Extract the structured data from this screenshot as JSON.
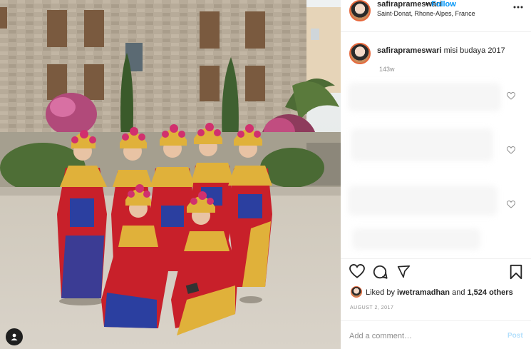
{
  "post": {
    "username": "safiraprameswari",
    "separator": "•",
    "follow_label": "Follow",
    "location": "Saint-Donat, Rhone-Alpes, France",
    "caption": {
      "username": "safiraprameswari",
      "text": "misi budaya 2017",
      "time": "143w"
    },
    "likes": {
      "prefix": "Liked by",
      "user": "iwetramadhan",
      "connector": "and",
      "others": "1,524 others"
    },
    "date": "AUGUST 2, 2017",
    "comment_placeholder": "Add a comment…",
    "post_label": "Post"
  },
  "icons": {
    "header": "more-options-icon",
    "actions": [
      "heart-icon",
      "comment-bubble-icon",
      "share-paper-plane-icon",
      "bookmark-icon"
    ],
    "photo": "user-tag-icon",
    "comment_likes": [
      "heart-outline-icon",
      "heart-outline-icon",
      "heart-outline-icon"
    ]
  },
  "colors": {
    "follow": "#0095f6",
    "post_button_disabled": "#b2dffc",
    "muted_text": "#8e8e8e",
    "costume_red": "#c8202a",
    "costume_gold": "#e0b13a",
    "costume_blue": "#2b3fa0"
  }
}
